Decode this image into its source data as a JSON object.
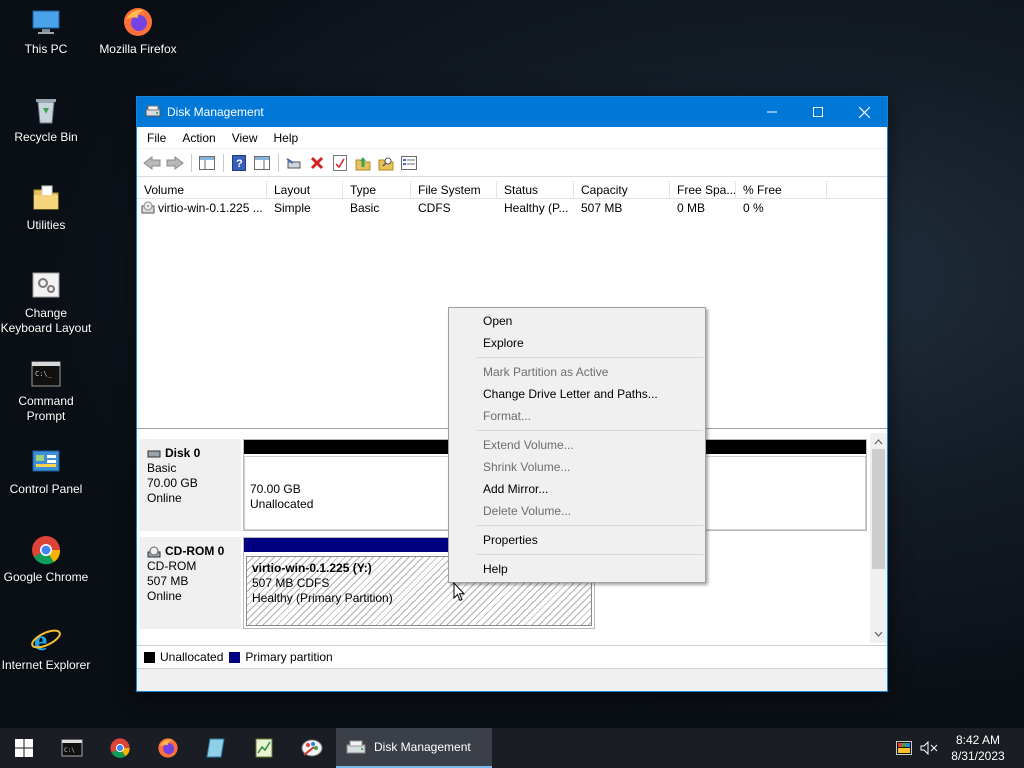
{
  "desktop": {
    "icons": [
      {
        "label": "This PC"
      },
      {
        "label": "Mozilla Firefox"
      },
      {
        "label": "Recycle Bin"
      },
      {
        "label": "Utilities"
      },
      {
        "label": "Change Keyboard Layout"
      },
      {
        "label": "Command Prompt"
      },
      {
        "label": "Control Panel"
      },
      {
        "label": "Google Chrome"
      },
      {
        "label": "Internet Explorer"
      }
    ]
  },
  "window": {
    "title": "Disk Management",
    "menu": [
      "File",
      "Action",
      "View",
      "Help"
    ]
  },
  "volume_table": {
    "columns": [
      "Volume",
      "Layout",
      "Type",
      "File System",
      "Status",
      "Capacity",
      "Free Spa...",
      "% Free"
    ],
    "rows": [
      [
        "virtio-win-0.1.225 ...",
        "Simple",
        "Basic",
        "CDFS",
        "Healthy (P...",
        "507 MB",
        "0 MB",
        "0 %"
      ]
    ]
  },
  "disks": [
    {
      "name": "Disk 0",
      "type": "Basic",
      "size": "70.00 GB",
      "state": "Online",
      "partition": {
        "line1": "70.00 GB",
        "line2": "Unallocated"
      }
    },
    {
      "name": "CD-ROM 0",
      "type": "CD-ROM",
      "size": "507 MB",
      "state": "Online",
      "partition": {
        "title": "virtio-win-0.1.225  (Y:)",
        "line1": "507 MB CDFS",
        "line2": "Healthy (Primary Partition)"
      }
    }
  ],
  "legend": {
    "unallocated": "Unallocated",
    "primary": "Primary partition"
  },
  "colors": {
    "unallocated": "#000000",
    "primary": "#000080",
    "accent": "#0078d7"
  },
  "context_menu": {
    "open": "Open",
    "explore": "Explore",
    "mark_active": "Mark Partition as Active",
    "change_letter": "Change Drive Letter and Paths...",
    "format": "Format...",
    "extend": "Extend Volume...",
    "shrink": "Shrink Volume...",
    "add_mirror": "Add Mirror...",
    "delete": "Delete Volume...",
    "properties": "Properties",
    "help": "Help"
  },
  "taskbar": {
    "active_label": "Disk Management",
    "time": "8:42 AM",
    "date": "8/31/2023"
  }
}
